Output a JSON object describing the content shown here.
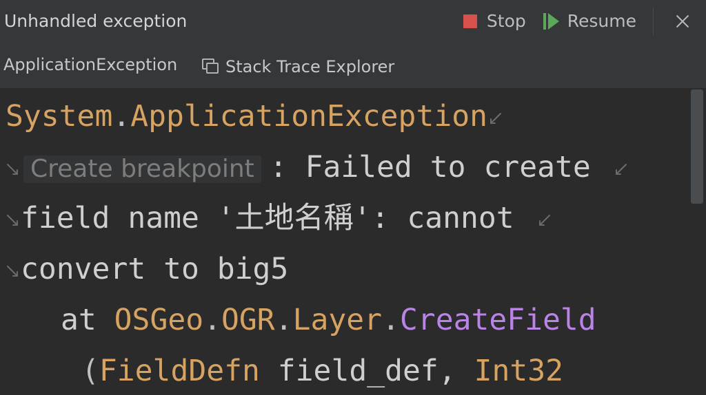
{
  "window": {
    "title": "Unhandled exception",
    "actions": {
      "stop_label": "Stop",
      "resume_label": "Resume"
    }
  },
  "tabs": {
    "exception_tab_label": "ApplicationException",
    "stack_trace_tab_label": "Stack Trace Explorer"
  },
  "hint": {
    "create_breakpoint_label": "Create breakpoint"
  },
  "code": {
    "line1": {
      "namespace": "System",
      "dot": ".",
      "type": "ApplicationException"
    },
    "line2": {
      "text": ": Failed to create "
    },
    "line3": {
      "text": "field name '土地名稱': cannot "
    },
    "line4": {
      "text": "convert to big5"
    },
    "line5": {
      "prefix": "at ",
      "namespace1": "OSGeo",
      "dot1": ".",
      "namespace2": "OGR",
      "dot2": ".",
      "type": "Layer",
      "dot3": ".",
      "method": "CreateField"
    },
    "line6": {
      "open_paren": "(",
      "type1": "FieldDefn",
      "param": " field_def, ",
      "type2": "Int32"
    }
  },
  "colors": {
    "background": "#2b2b2b",
    "header_background": "#353739",
    "type_color": "#d6a363",
    "method_color": "#b983e8",
    "plain_color": "#cfcfcf",
    "stop_color": "#d6504c",
    "resume_color": "#5ca85a"
  },
  "icons": {
    "stop": "stop-icon",
    "resume": "resume-icon",
    "close": "close-icon",
    "stack_trace_explorer": "stack-trace-explorer-icon",
    "soft_wrap": "soft-wrap-icon"
  }
}
